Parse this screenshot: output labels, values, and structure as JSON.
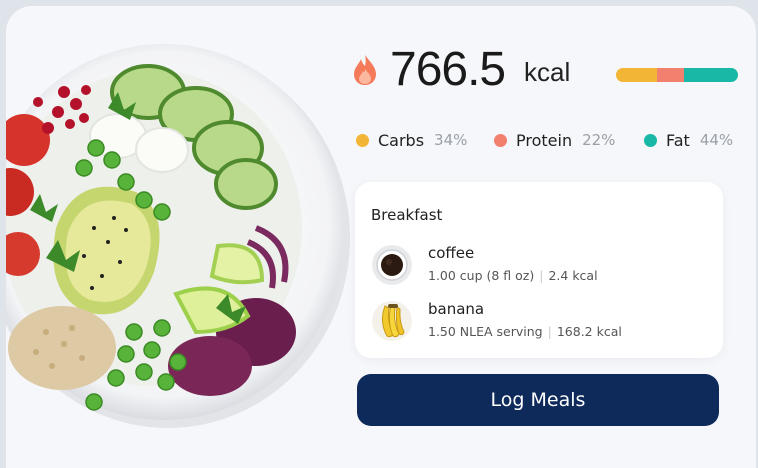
{
  "summary": {
    "calories_value": "766.5",
    "calories_unit": "kcal",
    "flame_icon": "flame-icon",
    "macro_fractions": {
      "carbs": 0.34,
      "protein": 0.22,
      "fat": 0.44
    }
  },
  "macros": [
    {
      "name": "Carbs",
      "percent": "34%",
      "color": "#f2b535"
    },
    {
      "name": "Protein",
      "percent": "22%",
      "color": "#f2806e"
    },
    {
      "name": "Fat",
      "percent": "44%",
      "color": "#19b8a6"
    }
  ],
  "meal": {
    "title": "Breakfast",
    "items": [
      {
        "name": "coffee",
        "amount": "1.00 cup (8 fl oz)",
        "calories": "2.4 kcal",
        "icon": "coffee-cup-icon"
      },
      {
        "name": "banana",
        "amount": "1.50 NLEA serving",
        "calories": "168.2 kcal",
        "icon": "banana-icon"
      }
    ]
  },
  "action": {
    "log_label": "Log Meals"
  },
  "colors": {
    "button": "#0e2a5a",
    "flame": "#f47a5a",
    "background": "#f6f7fa"
  }
}
